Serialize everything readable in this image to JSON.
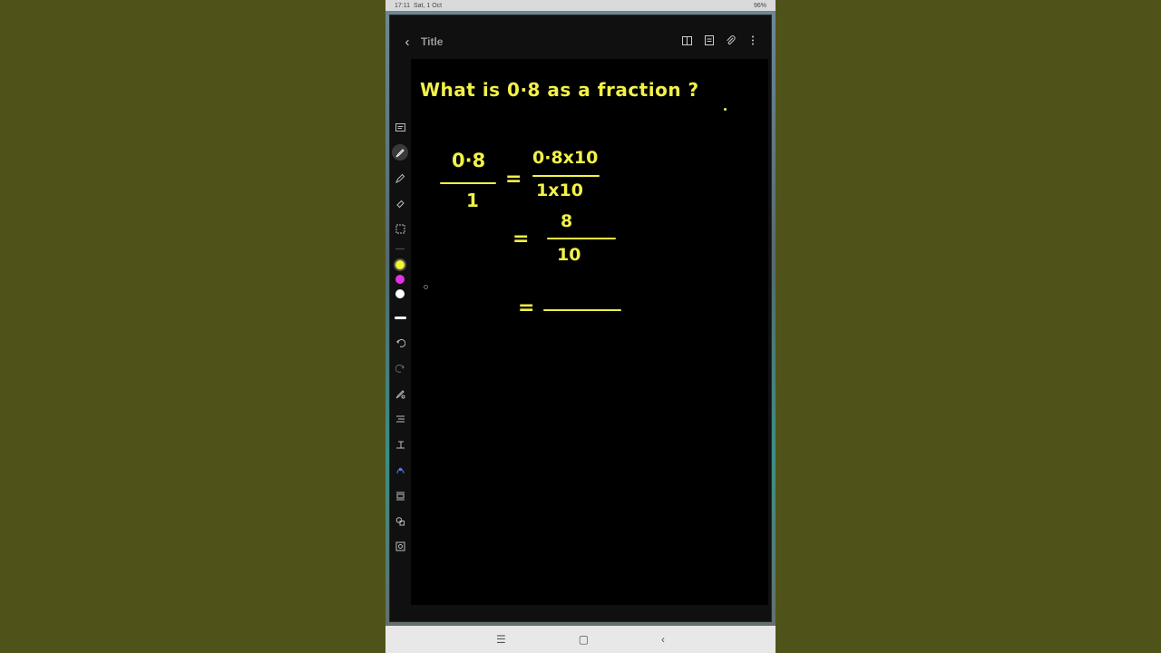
{
  "status": {
    "time": "17:11",
    "date": "Sat, 1 Oct",
    "battery": "96%"
  },
  "app": {
    "title": "Title"
  },
  "note": {
    "question": "What is 0·8 as a fraction ?",
    "eq1_num": "0·8",
    "eq1_den": "1",
    "eq1_equals": "=",
    "eq2_num": "0·8x10",
    "eq2_den": "1x10",
    "eq3_equals": "=",
    "eq3_num": "8",
    "eq3_den": "10",
    "eq4_equals": "="
  },
  "pen_colors": [
    "#f5f529",
    "#e232e6",
    "#ffffff"
  ],
  "icons": {
    "top": [
      "book-view-icon",
      "page-icon",
      "attach-icon",
      "more-icon"
    ],
    "tools": [
      "text-mode-icon",
      "pen-icon",
      "highlighter-icon",
      "eraser-icon",
      "lasso-icon",
      "stroke-width-icon",
      "undo-icon",
      "redo-icon",
      "pen-settings-icon",
      "align-icon",
      "text-icon",
      "shape-icon",
      "insert-text-icon",
      "shapes-icon",
      "image-icon"
    ]
  }
}
